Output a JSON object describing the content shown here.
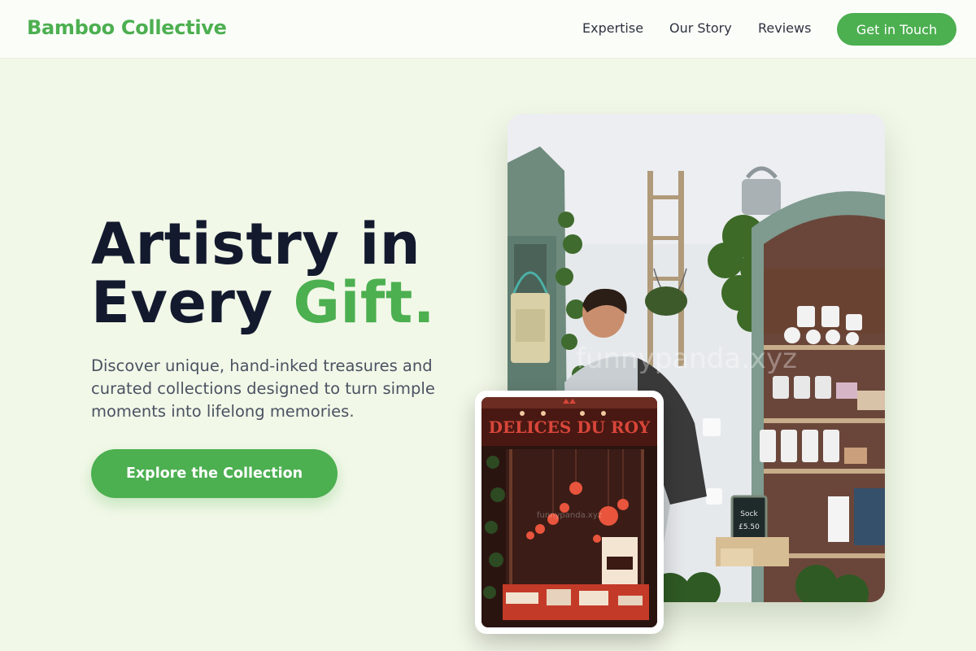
{
  "header": {
    "logo": "Bamboo Collective",
    "nav": [
      {
        "label": "Expertise"
      },
      {
        "label": "Our Story"
      },
      {
        "label": "Reviews"
      }
    ],
    "cta_label": "Get in Touch"
  },
  "hero": {
    "title_line1": "Artistry in",
    "title_line2_plain": "Every ",
    "title_line2_accent": "Gift.",
    "description": "Discover unique, hand-inked treasures and curated collections designed to turn simple moments into lifelong memories.",
    "button_label": "Explore the Collection"
  },
  "images": {
    "main_watermark": "funnypanda.xyz",
    "inset_sign": "DELICES DU ROY",
    "inset_watermark": "funnypanda.xyz",
    "chalkboard_text_1": "Sock",
    "chalkboard_text_2": "£5.50"
  },
  "colors": {
    "accent": "#4caf50",
    "background": "#f2f8e8",
    "heading": "#131a2e",
    "body_text": "#4a5262"
  }
}
